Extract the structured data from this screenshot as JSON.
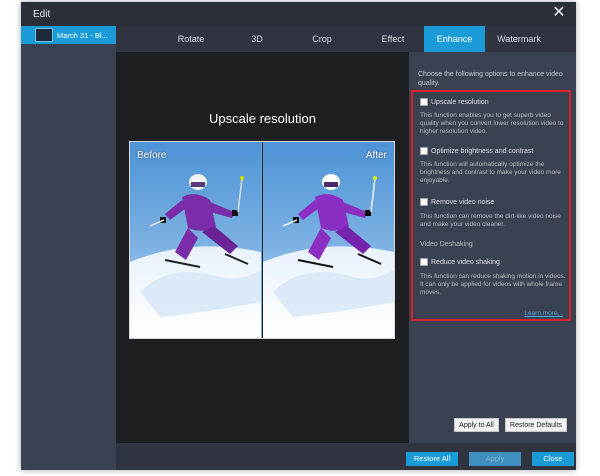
{
  "window": {
    "title": "Edit",
    "close_glyph": "✕"
  },
  "sidebar": {
    "items": [
      {
        "label": "March 31 - Bl...",
        "selected": true
      }
    ]
  },
  "tabs": [
    {
      "label": "Rotate",
      "active": false
    },
    {
      "label": "3D",
      "active": false
    },
    {
      "label": "Crop",
      "active": false
    },
    {
      "label": "Effect",
      "active": false
    },
    {
      "label": "Enhance",
      "active": true
    },
    {
      "label": "Watermark",
      "active": false
    }
  ],
  "preview": {
    "title": "Upscale resolution",
    "before_label": "Before",
    "after_label": "After"
  },
  "enhance": {
    "intro": "Choose the following options to enhance video quality.",
    "options": [
      {
        "label": "Upscale resolution",
        "checked": false,
        "description": "This function enables you to get superb video quality when you convert lower resolution video to higher resolution video."
      },
      {
        "label": "Optimize brightness and contrast",
        "checked": false,
        "description": "This function will automatically optimize the brightness and contrast to make your video more enjoyable."
      },
      {
        "label": "Remove video noise",
        "checked": false,
        "description": "This function can remove the dirt-like video noise and make your video cleaner."
      }
    ],
    "deshake_section": "Video Deshaking",
    "deshake_option": {
      "label": "Reduce video shaking",
      "checked": false,
      "description": "This function can reduce shaking motion in videos. It can only be applied for videos with whole frame moves."
    },
    "learn_more": "Learn more...",
    "apply_to_all": "Apply to All",
    "restore_defaults": "Restore Defaults"
  },
  "footer": {
    "restore_all": "Restore All",
    "apply": "Apply",
    "close": "Close"
  },
  "colors": {
    "accent": "#1a9bd7",
    "highlight_border": "#d7202a",
    "window_bg": "#2f3440",
    "panel_bg": "#3a4150"
  }
}
